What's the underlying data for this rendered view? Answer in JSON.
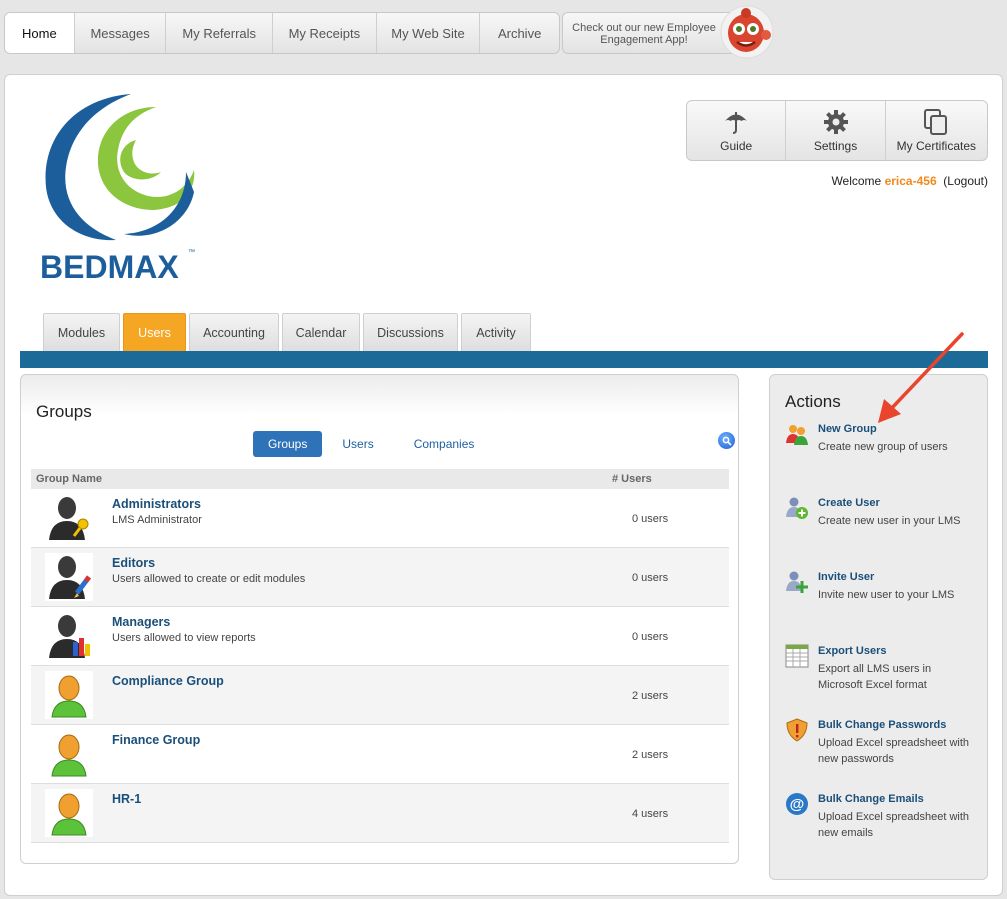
{
  "topnav": {
    "items": [
      {
        "label": "Home",
        "active": true
      },
      {
        "label": "Messages"
      },
      {
        "label": "My Referrals"
      },
      {
        "label": "My Receipts"
      },
      {
        "label": "My Web Site"
      },
      {
        "label": "Archive"
      }
    ],
    "promo": "Check out our new Employee Engagement App!"
  },
  "brand": {
    "logo_text": "BEDMAX",
    "tm": "™"
  },
  "toolbar": {
    "guide": "Guide",
    "settings": "Settings",
    "certificates": "My Certificates"
  },
  "welcome": {
    "prefix": "Welcome",
    "user": "erica-456",
    "logout": "(Logout)"
  },
  "subtabs": [
    "Modules",
    "Users",
    "Accounting",
    "Calendar",
    "Discussions",
    "Activity"
  ],
  "groups": {
    "title": "Groups",
    "tabs": [
      "Groups",
      "Users",
      "Companies"
    ],
    "columns": {
      "name": "Group Name",
      "users": "# Users"
    },
    "rows": [
      {
        "name": "Administrators",
        "desc": "LMS Administrator",
        "count": "0 users",
        "icon": "admin-avatar"
      },
      {
        "name": "Editors",
        "desc": "Users allowed to create or edit modules",
        "count": "0 users",
        "icon": "editor-avatar"
      },
      {
        "name": "Managers",
        "desc": "Users allowed to view reports",
        "count": "0 users",
        "icon": "manager-avatar"
      },
      {
        "name": "Compliance Group",
        "desc": "",
        "count": "2 users",
        "icon": "user-avatar"
      },
      {
        "name": "Finance Group",
        "desc": "",
        "count": "2 users",
        "icon": "user-avatar"
      },
      {
        "name": "HR-1",
        "desc": "",
        "count": "4 users",
        "icon": "user-avatar"
      }
    ]
  },
  "actions": {
    "title": "Actions",
    "items": [
      {
        "title": "New Group",
        "desc": "Create new group of users",
        "icon": "new-group-icon"
      },
      {
        "title": "Create User",
        "desc": "Create new user in your LMS",
        "icon": "create-user-icon"
      },
      {
        "title": "Invite User",
        "desc": "Invite new user to your LMS",
        "icon": "invite-user-icon"
      },
      {
        "title": "Export Users",
        "desc": "Export all LMS users in Microsoft Excel format",
        "icon": "spreadsheet-icon"
      },
      {
        "title": "Bulk Change Passwords",
        "desc": "Upload Excel spreadsheet with new passwords",
        "icon": "shield-warning-icon"
      },
      {
        "title": "Bulk Change Emails",
        "desc": "Upload Excel spreadsheet with new emails",
        "icon": "at-sign-icon"
      }
    ]
  },
  "colors": {
    "accent_orange": "#f5a623",
    "nav_blue": "#1b6a97",
    "link_blue": "#1a4f7a",
    "button_blue": "#2e72b8",
    "annotation_arrow": "#e8452c"
  }
}
